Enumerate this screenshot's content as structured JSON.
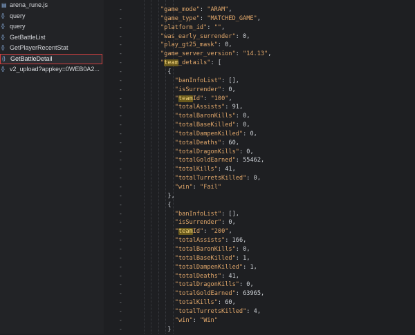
{
  "sidebar": {
    "items": [
      {
        "label": "arena_rune.js",
        "icon": "script-file-icon",
        "selected": false
      },
      {
        "label": "query",
        "icon": "curly-braces-icon",
        "selected": false
      },
      {
        "label": "query",
        "icon": "curly-braces-icon",
        "selected": false
      },
      {
        "label": "GetBattleList",
        "icon": "curly-braces-icon",
        "selected": false
      },
      {
        "label": "GetPlayerRecentStat",
        "icon": "curly-braces-icon",
        "selected": false
      },
      {
        "label": "GetBattleDetail",
        "icon": "curly-braces-icon",
        "selected": true
      },
      {
        "label": "v2_upload?appkey=0WEB0A2...",
        "icon": "curly-braces-icon",
        "selected": false
      }
    ]
  },
  "gutter_marker": "-",
  "code_lines": [
    {
      "indent": 6,
      "key": "\"game_mode\"",
      "sep": ": ",
      "val": "\"ARAM\"",
      "end": ",",
      "vtype": "str"
    },
    {
      "indent": 6,
      "key": "\"game_type\"",
      "sep": ": ",
      "val": "\"MATCHED_GAME\"",
      "end": ",",
      "vtype": "str"
    },
    {
      "indent": 6,
      "key": "\"platform_id\"",
      "sep": ": ",
      "val": "\"\"",
      "end": ",",
      "vtype": "str"
    },
    {
      "indent": 6,
      "key": "\"was_early_surrender\"",
      "sep": ": ",
      "val": "0",
      "end": ",",
      "vtype": "num"
    },
    {
      "indent": 6,
      "key": "\"play_gt25_mask\"",
      "sep": ": ",
      "val": "0",
      "end": ",",
      "vtype": "num"
    },
    {
      "indent": 6,
      "key": "\"game_server_version\"",
      "sep": ": ",
      "val": "\"14.13\"",
      "end": ",",
      "vtype": "str"
    },
    {
      "indent": 6,
      "key": "\"team_details\"",
      "sep": ": ",
      "val": "[",
      "end": "",
      "vtype": "punc",
      "highlight": "team"
    },
    {
      "indent": 8,
      "punc": "{"
    },
    {
      "indent": 10,
      "key": "\"banInfoList\"",
      "sep": ": ",
      "val": "[]",
      "end": ",",
      "vtype": "punc"
    },
    {
      "indent": 10,
      "key": "\"isSurrender\"",
      "sep": ": ",
      "val": "0",
      "end": ",",
      "vtype": "num"
    },
    {
      "indent": 10,
      "key": "\"teamId\"",
      "sep": ": ",
      "val": "\"100\"",
      "end": ",",
      "vtype": "str",
      "highlight": "team"
    },
    {
      "indent": 10,
      "key": "\"totalAssists\"",
      "sep": ": ",
      "val": "91",
      "end": ",",
      "vtype": "num"
    },
    {
      "indent": 10,
      "key": "\"totalBaronKills\"",
      "sep": ": ",
      "val": "0",
      "end": ",",
      "vtype": "num"
    },
    {
      "indent": 10,
      "key": "\"totalBaseKilled\"",
      "sep": ": ",
      "val": "0",
      "end": ",",
      "vtype": "num"
    },
    {
      "indent": 10,
      "key": "\"totalDampenKilled\"",
      "sep": ": ",
      "val": "0",
      "end": ",",
      "vtype": "num"
    },
    {
      "indent": 10,
      "key": "\"totalDeaths\"",
      "sep": ": ",
      "val": "60",
      "end": ",",
      "vtype": "num"
    },
    {
      "indent": 10,
      "key": "\"totalDragonKills\"",
      "sep": ": ",
      "val": "0",
      "end": ",",
      "vtype": "num"
    },
    {
      "indent": 10,
      "key": "\"totalGoldEarned\"",
      "sep": ": ",
      "val": "55462",
      "end": ",",
      "vtype": "num"
    },
    {
      "indent": 10,
      "key": "\"totalKills\"",
      "sep": ": ",
      "val": "41",
      "end": ",",
      "vtype": "num"
    },
    {
      "indent": 10,
      "key": "\"totalTurretsKilled\"",
      "sep": ": ",
      "val": "0",
      "end": ",",
      "vtype": "num"
    },
    {
      "indent": 10,
      "key": "\"win\"",
      "sep": ": ",
      "val": "\"Fail\"",
      "end": "",
      "vtype": "str"
    },
    {
      "indent": 8,
      "punc": "},"
    },
    {
      "indent": 8,
      "punc": "{"
    },
    {
      "indent": 10,
      "key": "\"banInfoList\"",
      "sep": ": ",
      "val": "[]",
      "end": ",",
      "vtype": "punc"
    },
    {
      "indent": 10,
      "key": "\"isSurrender\"",
      "sep": ": ",
      "val": "0",
      "end": ",",
      "vtype": "num"
    },
    {
      "indent": 10,
      "key": "\"teamId\"",
      "sep": ": ",
      "val": "\"200\"",
      "end": ",",
      "vtype": "str",
      "highlight": "team"
    },
    {
      "indent": 10,
      "key": "\"totalAssists\"",
      "sep": ": ",
      "val": "166",
      "end": ",",
      "vtype": "num"
    },
    {
      "indent": 10,
      "key": "\"totalBaronKills\"",
      "sep": ": ",
      "val": "0",
      "end": ",",
      "vtype": "num"
    },
    {
      "indent": 10,
      "key": "\"totalBaseKilled\"",
      "sep": ": ",
      "val": "1",
      "end": ",",
      "vtype": "num"
    },
    {
      "indent": 10,
      "key": "\"totalDampenKilled\"",
      "sep": ": ",
      "val": "1",
      "end": ",",
      "vtype": "num"
    },
    {
      "indent": 10,
      "key": "\"totalDeaths\"",
      "sep": ": ",
      "val": "41",
      "end": ",",
      "vtype": "num"
    },
    {
      "indent": 10,
      "key": "\"totalDragonKills\"",
      "sep": ": ",
      "val": "0",
      "end": ",",
      "vtype": "num"
    },
    {
      "indent": 10,
      "key": "\"totalGoldEarned\"",
      "sep": ": ",
      "val": "63965",
      "end": ",",
      "vtype": "num"
    },
    {
      "indent": 10,
      "key": "\"totalKills\"",
      "sep": ": ",
      "val": "60",
      "end": ",",
      "vtype": "num"
    },
    {
      "indent": 10,
      "key": "\"totalTurretsKilled\"",
      "sep": ": ",
      "val": "4",
      "end": ",",
      "vtype": "num"
    },
    {
      "indent": 10,
      "key": "\"win\"",
      "sep": ": ",
      "val": "\"Win\"",
      "end": "",
      "vtype": "str"
    },
    {
      "indent": 8,
      "punc": "}"
    }
  ],
  "colors": {
    "background": "#1e1f22",
    "json_key": "#e2a86b",
    "json_string": "#e2a86b",
    "json_number": "#cfd3d8",
    "selection_border": "#d33f3f",
    "search_highlight": "#6a5a1c"
  }
}
